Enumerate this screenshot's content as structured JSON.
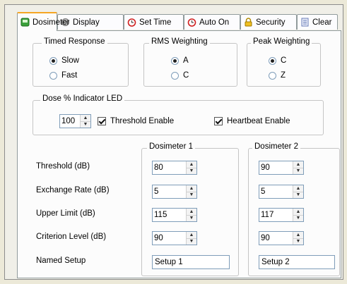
{
  "tabs": [
    {
      "label": "Dosimeter",
      "icon": "dosimeter-icon",
      "active": true
    },
    {
      "label": "Display",
      "icon": "gear-icon"
    },
    {
      "label": "Set Time",
      "icon": "clock-icon"
    },
    {
      "label": "Auto On",
      "icon": "clock-icon"
    },
    {
      "label": "Security",
      "icon": "lock-icon"
    },
    {
      "label": "Clear",
      "icon": "clear-icon"
    }
  ],
  "timed_response": {
    "title": "Timed Response",
    "options": [
      "Slow",
      "Fast"
    ],
    "selected": "Slow"
  },
  "rms_weighting": {
    "title": "RMS Weighting",
    "options": [
      "A",
      "C"
    ],
    "selected": "A"
  },
  "peak_weighting": {
    "title": "Peak Weighting",
    "options": [
      "C",
      "Z"
    ],
    "selected": "C"
  },
  "dose_led": {
    "title": "Dose % Indicator LED",
    "value": "100",
    "threshold_enable": {
      "label": "Threshold Enable",
      "checked": true
    },
    "heartbeat_enable": {
      "label": "Heartbeat Enable",
      "checked": true
    }
  },
  "settings": {
    "rows": [
      "Threshold (dB)",
      "Exchange Rate (dB)",
      "Upper Limit (dB)",
      "Criterion Level (dB)",
      "Named Setup"
    ],
    "dosimeter1": {
      "title": "Dosimeter 1",
      "threshold": "80",
      "exchange_rate": "5",
      "upper_limit": "115",
      "criterion_level": "90",
      "named_setup": "Setup 1"
    },
    "dosimeter2": {
      "title": "Dosimeter 2",
      "threshold": "90",
      "exchange_rate": "5",
      "upper_limit": "117",
      "criterion_level": "90",
      "named_setup": "Setup 2"
    }
  }
}
